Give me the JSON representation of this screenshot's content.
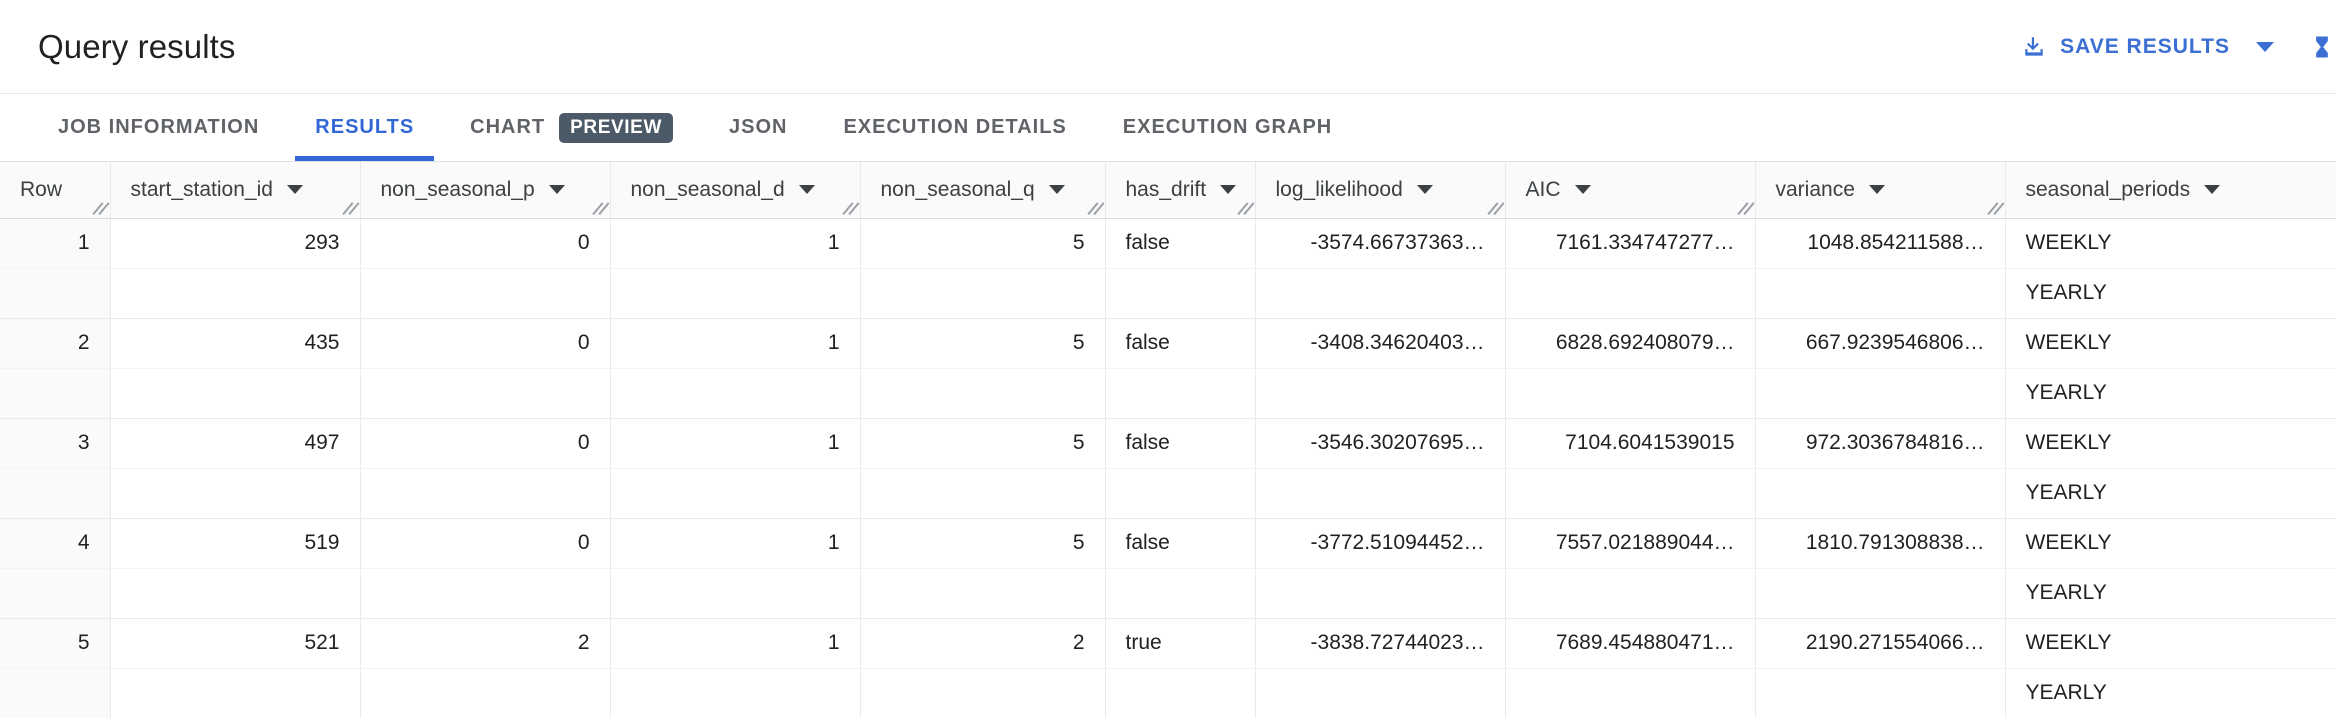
{
  "header": {
    "title": "Query results",
    "save_results_label": "SAVE RESULTS",
    "download_icon": "download-icon",
    "dropdown_caret_icon": "chevron-down-icon",
    "accent_color": "#3b6fd4"
  },
  "tabs": [
    {
      "label": "JOB INFORMATION",
      "active": false,
      "badge": null
    },
    {
      "label": "RESULTS",
      "active": true,
      "badge": null
    },
    {
      "label": "CHART",
      "active": false,
      "badge": "PREVIEW"
    },
    {
      "label": "JSON",
      "active": false,
      "badge": null
    },
    {
      "label": "EXECUTION DETAILS",
      "active": false,
      "badge": null
    },
    {
      "label": "EXECUTION GRAPH",
      "active": false,
      "badge": null
    }
  ],
  "colors": {
    "active_tab": "#3367d6",
    "inactive_tab": "#5f6368",
    "badge_bg": "#4b5a66",
    "header_bg": "#fafafa",
    "grid_line": "#e8eaed"
  },
  "table": {
    "columns": [
      {
        "key": "row",
        "label": "Row",
        "align": "right",
        "sortable": false,
        "resizable": true
      },
      {
        "key": "start_station_id",
        "label": "start_station_id",
        "align": "right",
        "sortable": true,
        "resizable": true
      },
      {
        "key": "non_seasonal_p",
        "label": "non_seasonal_p",
        "align": "right",
        "sortable": true,
        "resizable": true
      },
      {
        "key": "non_seasonal_d",
        "label": "non_seasonal_d",
        "align": "right",
        "sortable": true,
        "resizable": true
      },
      {
        "key": "non_seasonal_q",
        "label": "non_seasonal_q",
        "align": "right",
        "sortable": true,
        "resizable": true
      },
      {
        "key": "has_drift",
        "label": "has_drift",
        "align": "left",
        "sortable": true,
        "resizable": true
      },
      {
        "key": "log_likelihood",
        "label": "log_likelihood",
        "align": "right",
        "sortable": true,
        "resizable": true
      },
      {
        "key": "AIC",
        "label": "AIC",
        "align": "right",
        "sortable": true,
        "resizable": true
      },
      {
        "key": "variance",
        "label": "variance",
        "align": "right",
        "sortable": true,
        "resizable": true
      },
      {
        "key": "seasonal_periods",
        "label": "seasonal_periods",
        "align": "left",
        "sortable": true,
        "resizable": false
      }
    ],
    "rows": [
      {
        "row": "1",
        "start_station_id": "293",
        "non_seasonal_p": "0",
        "non_seasonal_d": "1",
        "non_seasonal_q": "5",
        "has_drift": "false",
        "log_likelihood": "-3574.66737363…",
        "AIC": "7161.334747277…",
        "variance": "1048.854211588…",
        "seasonal_periods": [
          "WEEKLY",
          "YEARLY"
        ]
      },
      {
        "row": "2",
        "start_station_id": "435",
        "non_seasonal_p": "0",
        "non_seasonal_d": "1",
        "non_seasonal_q": "5",
        "has_drift": "false",
        "log_likelihood": "-3408.34620403…",
        "AIC": "6828.692408079…",
        "variance": "667.9239546806…",
        "seasonal_periods": [
          "WEEKLY",
          "YEARLY"
        ]
      },
      {
        "row": "3",
        "start_station_id": "497",
        "non_seasonal_p": "0",
        "non_seasonal_d": "1",
        "non_seasonal_q": "5",
        "has_drift": "false",
        "log_likelihood": "-3546.30207695…",
        "AIC": "7104.6041539015",
        "variance": "972.3036784816…",
        "seasonal_periods": [
          "WEEKLY",
          "YEARLY"
        ]
      },
      {
        "row": "4",
        "start_station_id": "519",
        "non_seasonal_p": "0",
        "non_seasonal_d": "1",
        "non_seasonal_q": "5",
        "has_drift": "false",
        "log_likelihood": "-3772.51094452…",
        "AIC": "7557.021889044…",
        "variance": "1810.791308838…",
        "seasonal_periods": [
          "WEEKLY",
          "YEARLY"
        ]
      },
      {
        "row": "5",
        "start_station_id": "521",
        "non_seasonal_p": "2",
        "non_seasonal_d": "1",
        "non_seasonal_q": "2",
        "has_drift": "true",
        "log_likelihood": "-3838.72744023…",
        "AIC": "7689.454880471…",
        "variance": "2190.271554066…",
        "seasonal_periods": [
          "WEEKLY",
          "YEARLY"
        ]
      }
    ]
  }
}
